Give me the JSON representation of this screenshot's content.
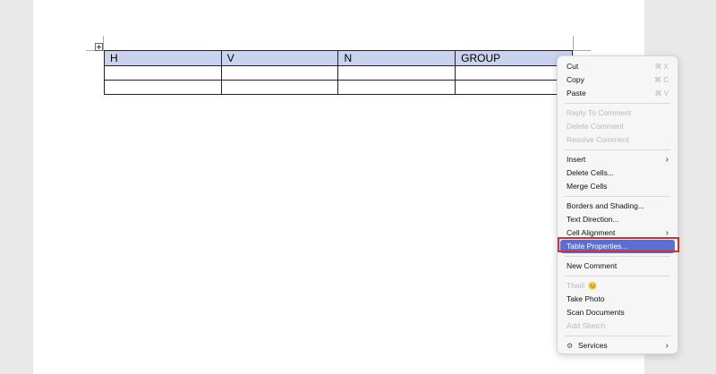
{
  "table": {
    "headers": [
      "H",
      "V",
      "N",
      "GROUP"
    ],
    "rows": [
      [
        "",
        "",
        "",
        ""
      ],
      [
        "",
        "",
        "",
        ""
      ]
    ]
  },
  "context_menu": {
    "items": [
      {
        "label": "Cut",
        "shortcut": "⌘ X",
        "disabled": false
      },
      {
        "label": "Copy",
        "shortcut": "⌘ C",
        "disabled": false
      },
      {
        "label": "Paste",
        "shortcut": "⌘ V",
        "disabled": false
      },
      {
        "label": "Reply To Comment",
        "disabled": true
      },
      {
        "label": "Delete Comment",
        "disabled": true
      },
      {
        "label": "Resolve Comment",
        "disabled": true
      },
      {
        "label": "Insert",
        "submenu": true
      },
      {
        "label": "Delete Cells..."
      },
      {
        "label": "Merge Cells"
      },
      {
        "label": "Borders and Shading..."
      },
      {
        "label": "Text Direction..."
      },
      {
        "label": "Cell Alignment",
        "submenu": true
      },
      {
        "label": "Table Properties...",
        "highlighted": true
      },
      {
        "label": "New Comment"
      },
      {
        "label": "Thaili",
        "disabled": true
      },
      {
        "label": "Take Photo"
      },
      {
        "label": "Scan Documents"
      },
      {
        "label": "Add Sketch",
        "disabled": true
      },
      {
        "label": "Services",
        "submenu": true
      }
    ]
  },
  "icons": {
    "table_move_handle": "move-handle-icon",
    "submenu": "chevron-right-icon",
    "services": "services-icon",
    "emoji": "emoji-icon"
  },
  "colors": {
    "header_fill": "#c9d3ef",
    "menu_highlight": "#5b6fd1",
    "annotation_box": "#d3302f"
  }
}
